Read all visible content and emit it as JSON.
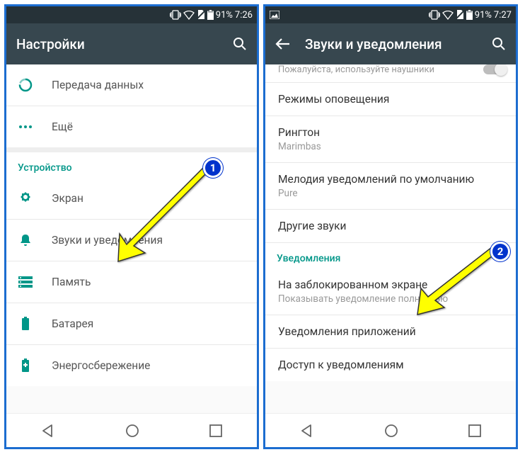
{
  "status": {
    "battery": "91%",
    "time1": "7:26",
    "time2": "7:27"
  },
  "screen1": {
    "title": "Настройки",
    "items": {
      "data": "Передача данных",
      "more": "Ещё"
    },
    "section_device": "Устройство",
    "device": {
      "display": "Экран",
      "sound": "Звуки и уведомления",
      "storage": "Память",
      "battery": "Батарея",
      "power": "Энергосбережение"
    }
  },
  "screen2": {
    "title": "Звуки и уведомления",
    "truncated_sub": "Пожалуйста, используйте наушники",
    "items": {
      "modes": "Режимы оповещения",
      "ringtone_title": "Рингтон",
      "ringtone_value": "Marimbas",
      "notif_sound_title": "Мелодия уведомлений по умолчанию",
      "notif_sound_value": "Pure",
      "other_sounds": "Другие звуки"
    },
    "section_notif": "Уведомления",
    "notif": {
      "lockscreen_title": "На заблокированном экране",
      "lockscreen_value": "Показывать уведомление полностью",
      "app_notif": "Уведомления приложений",
      "notif_access": "Доступ к уведомлениям"
    }
  },
  "annotations": {
    "num1": "1",
    "num2": "2"
  }
}
